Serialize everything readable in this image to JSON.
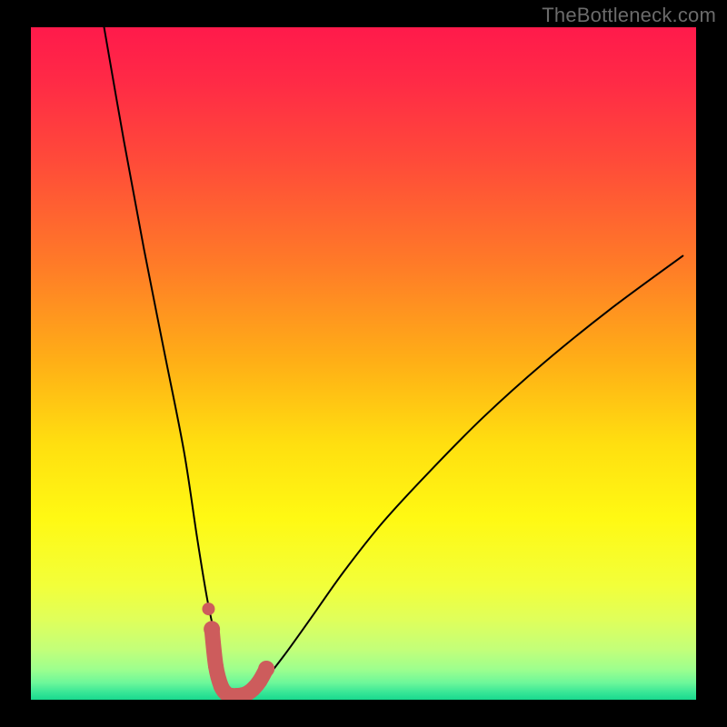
{
  "watermark": "TheBottleneck.com",
  "chart_data": {
    "type": "line",
    "title": "",
    "xlabel": "",
    "ylabel": "",
    "xlim": [
      0,
      100
    ],
    "ylim": [
      0,
      100
    ],
    "grid": false,
    "series": [
      {
        "name": "bottleneck-curve",
        "x": [
          11,
          14,
          17,
          20,
          23,
          25,
          26.5,
          28,
          29,
          30,
          31,
          32,
          33,
          35,
          38,
          42,
          47,
          53,
          60,
          68,
          77,
          87,
          98
        ],
        "y": [
          100,
          83,
          67,
          52,
          37,
          24,
          15,
          8,
          3.5,
          1,
          0.3,
          0.4,
          1.2,
          2.8,
          6.5,
          12,
          19,
          26.5,
          34,
          42,
          50,
          58,
          66
        ]
      }
    ],
    "highlight_segment": {
      "name": "bottom-marker",
      "color": "#cd5c5c",
      "points_x": [
        27.2,
        27.8,
        28.6,
        29.4,
        30.2,
        31.0,
        31.8,
        32.6,
        33.4,
        34.4,
        35.4
      ],
      "points_y": [
        10.5,
        5.0,
        2.0,
        0.9,
        0.6,
        0.6,
        0.7,
        1.0,
        1.6,
        2.8,
        4.6
      ]
    },
    "gradient": {
      "stops": [
        {
          "offset": 0.0,
          "color": "#ff1a4b"
        },
        {
          "offset": 0.08,
          "color": "#ff2a46"
        },
        {
          "offset": 0.2,
          "color": "#ff4b39"
        },
        {
          "offset": 0.35,
          "color": "#ff7a28"
        },
        {
          "offset": 0.5,
          "color": "#ffb016"
        },
        {
          "offset": 0.62,
          "color": "#ffdf10"
        },
        {
          "offset": 0.73,
          "color": "#fff913"
        },
        {
          "offset": 0.83,
          "color": "#f2ff3a"
        },
        {
          "offset": 0.88,
          "color": "#e0ff5a"
        },
        {
          "offset": 0.925,
          "color": "#c3ff79"
        },
        {
          "offset": 0.955,
          "color": "#9dff8e"
        },
        {
          "offset": 0.975,
          "color": "#6cf79a"
        },
        {
          "offset": 0.99,
          "color": "#35e596"
        },
        {
          "offset": 1.0,
          "color": "#19d98e"
        }
      ]
    }
  }
}
